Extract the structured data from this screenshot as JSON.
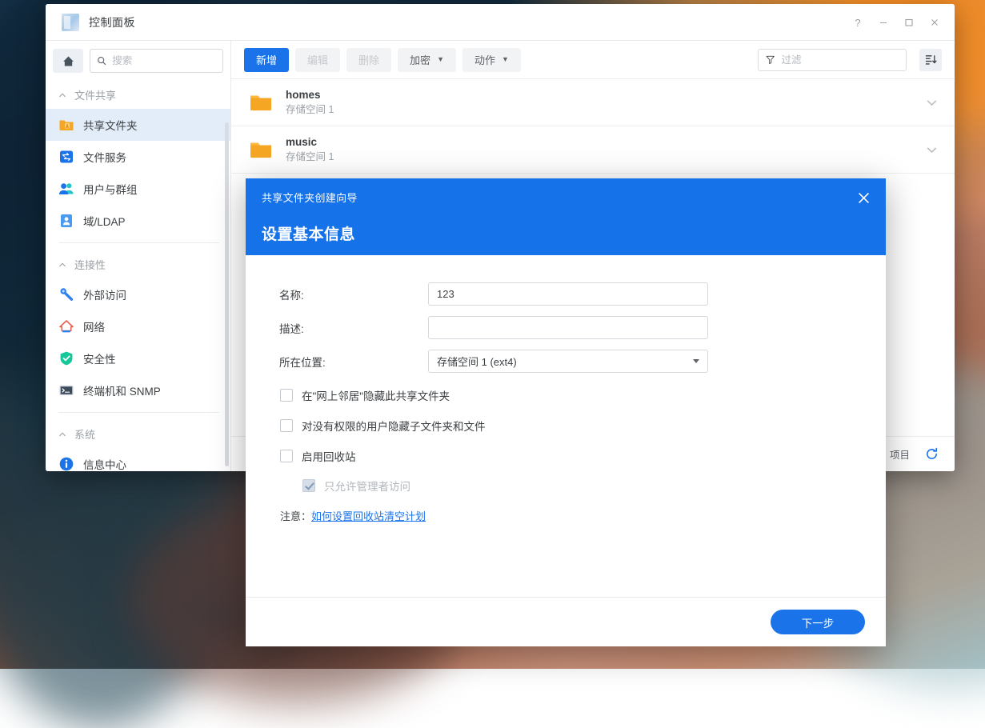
{
  "window": {
    "title": "控制面板",
    "controls": [
      {
        "name": "help-button",
        "glyph": "?"
      },
      {
        "name": "minimize-button",
        "glyph": "minimize"
      },
      {
        "name": "maximize-button",
        "glyph": "maximize"
      },
      {
        "name": "close-button",
        "glyph": "close"
      }
    ]
  },
  "sidebar": {
    "home_icon": "home-icon",
    "search": {
      "placeholder": "搜索",
      "value": ""
    },
    "groups": [
      {
        "label": "文件共享",
        "items": [
          {
            "label": "共享文件夹",
            "icon": "shared-folder-icon",
            "active": true
          },
          {
            "label": "文件服务",
            "icon": "file-service-icon",
            "active": false
          },
          {
            "label": "用户与群组",
            "icon": "users-groups-icon",
            "active": false
          },
          {
            "label": "域/LDAP",
            "icon": "domain-ldap-icon",
            "active": false
          }
        ]
      },
      {
        "label": "连接性",
        "items": [
          {
            "label": "外部访问",
            "icon": "external-access-icon",
            "active": false
          },
          {
            "label": "网络",
            "icon": "network-icon",
            "active": false
          },
          {
            "label": "安全性",
            "icon": "security-shield-icon",
            "active": false
          },
          {
            "label": "终端机和 SNMP",
            "icon": "terminal-snmp-icon",
            "active": false
          }
        ]
      },
      {
        "label": "系统",
        "items": [
          {
            "label": "信息中心",
            "icon": "info-center-icon",
            "active": false
          }
        ]
      }
    ]
  },
  "toolbar": {
    "create": "新增",
    "edit": "编辑",
    "delete": "删除",
    "encrypt": "加密",
    "action": "动作",
    "filter": {
      "placeholder": "过滤",
      "value": ""
    },
    "sort_icon": "sort-list-icon"
  },
  "list": {
    "rows": [
      {
        "name": "homes",
        "location": "存储空间 1",
        "icon": "folder-icon",
        "chevron": "chevron-down-icon"
      },
      {
        "name": "music",
        "location": "存储空间 1",
        "icon": "folder-icon",
        "chevron": "chevron-down-icon"
      }
    ]
  },
  "statusbar": {
    "items_label": "项目",
    "refresh_icon": "refresh-icon"
  },
  "modal": {
    "breadcrumb": "共享文件夹创建向导",
    "title": "设置基本信息",
    "close_icon": "close-icon",
    "fields": [
      {
        "label": "名称:",
        "value": "123",
        "type": "text"
      },
      {
        "label": "描述:",
        "value": "",
        "type": "text"
      },
      {
        "label": "所在位置:",
        "value": "存储空间 1 (ext4)",
        "type": "select"
      }
    ],
    "checkboxes": [
      {
        "label": "在\"网上邻居\"隐藏此共享文件夹",
        "checked": false,
        "disabled": false,
        "indent": false
      },
      {
        "label": "对没有权限的用户隐藏子文件夹和文件",
        "checked": false,
        "disabled": false,
        "indent": false
      },
      {
        "label": "启用回收站",
        "checked": false,
        "disabled": false,
        "indent": false
      },
      {
        "label": "只允许管理者访问",
        "checked": true,
        "disabled": true,
        "indent": true
      }
    ],
    "note_label": "注意：",
    "note_link": "如何设置回收站清空计划",
    "next_button": "下一步"
  },
  "colors": {
    "accent": "#1a73e8",
    "modal_header": "#1572e8",
    "folder": "#f5a623",
    "active_item": "#e3ecf9"
  }
}
